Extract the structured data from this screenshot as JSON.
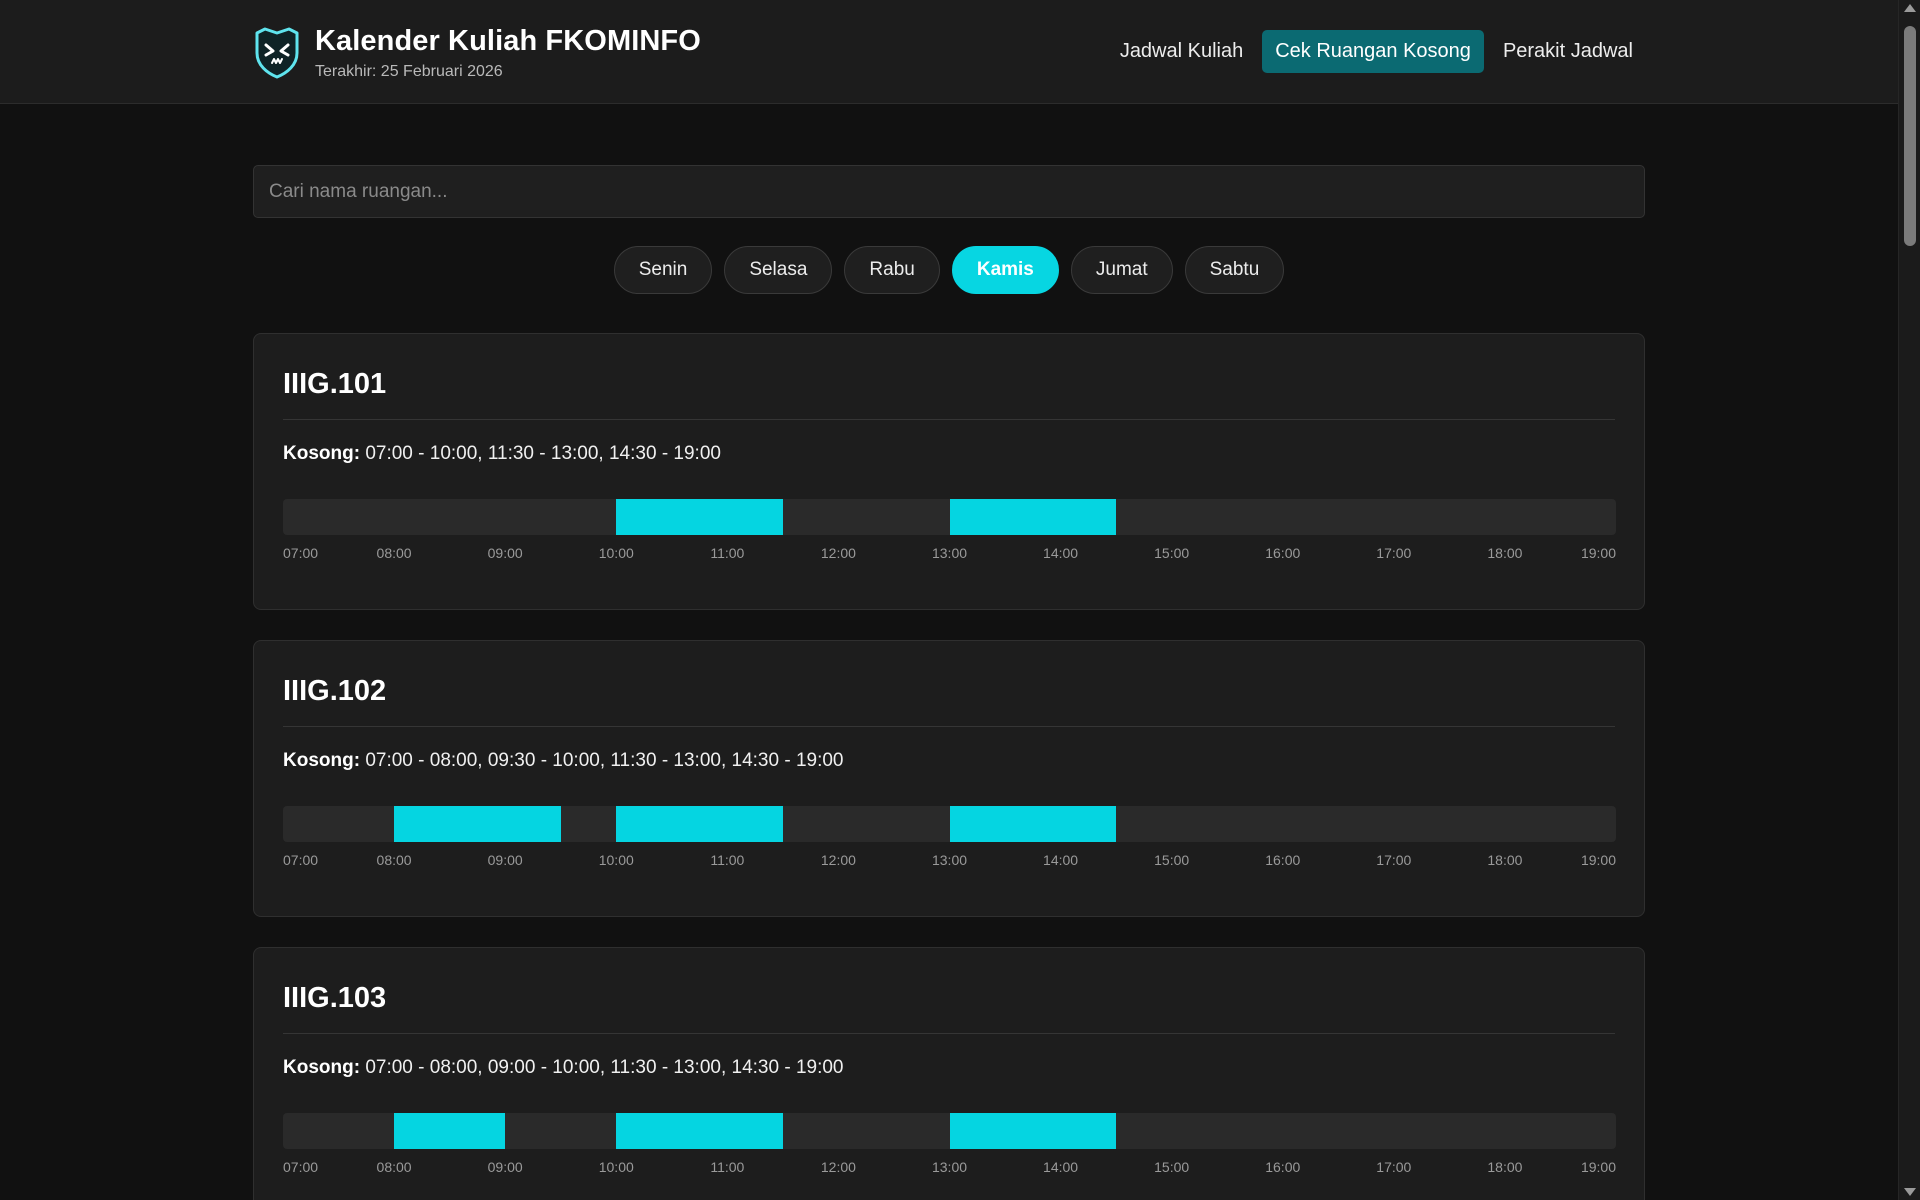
{
  "app": {
    "title": "Kalender Kuliah FKOMINFO",
    "updated": "Terakhir: 25 Februari 2026"
  },
  "nav": [
    {
      "label": "Jadwal Kuliah",
      "active": false
    },
    {
      "label": "Cek Ruangan Kosong",
      "active": true
    },
    {
      "label": "Perakit Jadwal",
      "active": false
    }
  ],
  "search": {
    "placeholder": "Cari nama ruangan...",
    "value": ""
  },
  "days": [
    {
      "label": "Senin",
      "active": false
    },
    {
      "label": "Selasa",
      "active": false
    },
    {
      "label": "Rabu",
      "active": false
    },
    {
      "label": "Kamis",
      "active": true
    },
    {
      "label": "Jumat",
      "active": false
    },
    {
      "label": "Sabtu",
      "active": false
    }
  ],
  "timeline": {
    "start": "07:00",
    "end": "19:00",
    "ticks": [
      "07:00",
      "08:00",
      "09:00",
      "10:00",
      "11:00",
      "12:00",
      "13:00",
      "14:00",
      "15:00",
      "16:00",
      "17:00",
      "18:00",
      "19:00"
    ]
  },
  "free_label": "Kosong:",
  "rooms": [
    {
      "name": "IIIG.101",
      "free": "07:00 - 10:00, 11:30 - 13:00, 14:30 - 19:00",
      "busy": [
        [
          "10:00",
          "11:30"
        ],
        [
          "13:00",
          "14:30"
        ]
      ]
    },
    {
      "name": "IIIG.102",
      "free": "07:00 - 08:00, 09:30 - 10:00, 11:30 - 13:00, 14:30 - 19:00",
      "busy": [
        [
          "08:00",
          "09:30"
        ],
        [
          "10:00",
          "11:30"
        ],
        [
          "13:00",
          "14:30"
        ]
      ]
    },
    {
      "name": "IIIG.103",
      "free": "07:00 - 08:00, 09:00 - 10:00, 11:30 - 13:00, 14:30 - 19:00",
      "busy": [
        [
          "08:00",
          "09:00"
        ],
        [
          "10:00",
          "11:30"
        ],
        [
          "13:00",
          "14:30"
        ]
      ]
    }
  ],
  "colors": {
    "accent": "#05d5e1",
    "nav_active": "#0b6a72",
    "background": "#111111",
    "card": "#1d1d1d"
  }
}
